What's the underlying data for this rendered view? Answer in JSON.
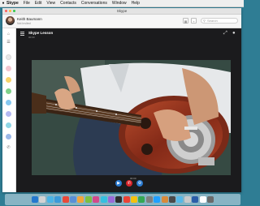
{
  "menubar": {
    "apple_symbol": "",
    "items": [
      {
        "label": "Skype"
      },
      {
        "label": "File"
      },
      {
        "label": "Edit"
      },
      {
        "label": "View"
      },
      {
        "label": "Contacts"
      },
      {
        "label": "Conversations"
      },
      {
        "label": "Window"
      },
      {
        "label": "Help"
      }
    ]
  },
  "window": {
    "title": "Skype"
  },
  "profile": {
    "name": "Keith Baumann",
    "status": "Not Invited",
    "search_placeholder": "Search",
    "search_icon": "search-icon"
  },
  "rail": {
    "icons": [
      "home-icon",
      "contacts-icon",
      "avatar-1",
      "avatar-2",
      "avatar-3",
      "avatar-4",
      "avatar-5",
      "avatar-6",
      "avatar-7",
      "dialpad-icon",
      "phone-icon"
    ]
  },
  "call": {
    "title": "Skype Lesson",
    "subtitle": "00:00",
    "video_caption": "00:00",
    "buttons": [
      {
        "name": "video-button",
        "color": "#2a7ad0",
        "glyph": "▶"
      },
      {
        "name": "end-call-button",
        "color": "#d9242a",
        "glyph": "✆"
      },
      {
        "name": "settings-button",
        "color": "#2a7ad0",
        "glyph": "⌂"
      }
    ]
  },
  "colors": {
    "desktop": "#2f7d94",
    "call_bg": "#1b1b1d",
    "end_call": "#d9242a",
    "accent": "#2a7ad0"
  },
  "dock": {
    "apps": [
      "#2478ce",
      "#d3d3d3",
      "#4ab4e6",
      "#3a9ad9",
      "#e84a3a",
      "#5a8fd6",
      "#f2a43a",
      "#7bc041",
      "#d24a8b",
      "#35c0e0",
      "#9a6ad8",
      "#2d2d2d",
      "#ea4335",
      "#f4c20d",
      "#34a853",
      "#7f7f7f",
      "#1fa0ff",
      "#d88a3a",
      "#4a4a4a",
      "#55b8e8",
      "#c9c9c9",
      "#2b5ea8",
      "#ffffff",
      "#6a6a6a"
    ]
  }
}
